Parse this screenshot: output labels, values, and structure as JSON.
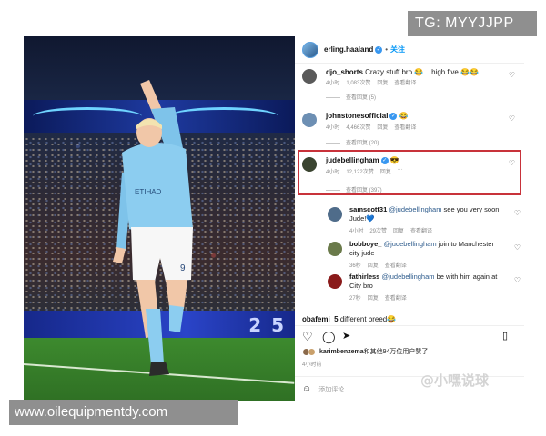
{
  "watermarks": {
    "tg": "TG: MYYJJPP",
    "site": "www.oilequipmentdy.com",
    "corner": "@小嘿说球"
  },
  "photo": {
    "jersey_text": "ETIHAD",
    "shorts_number": "9",
    "board_text": "2 5"
  },
  "post": {
    "username": "erling.haaland",
    "dot": "•",
    "follow_label": "关注"
  },
  "comments": [
    {
      "user": "djo_shorts",
      "text": "Crazy stuff bro 😂 .. high five 😂😂",
      "time": "4小时",
      "likes": "1,083次赞",
      "reply": "回复",
      "translate": "查看翻译",
      "replies": "查看回复 (5)"
    },
    {
      "user": "johnstonesofficial",
      "text": "😂",
      "time": "4小时",
      "likes": "4,466次赞",
      "reply": "回复",
      "translate": "查看翻译",
      "replies": "查看回复 (20)"
    },
    {
      "user": "judebellingham",
      "text": "😎",
      "time": "4小时",
      "likes": "12,122次赞",
      "reply": "回复",
      "more": "···",
      "replies": "查看回复 (397)"
    }
  ],
  "subreplies": [
    {
      "user": "samscott31",
      "mention": "@judebellingham",
      "text": " see you very soon Jude!💙",
      "time": "4小时",
      "likes": "29次赞",
      "reply": "回复",
      "translate": "查看翻译"
    },
    {
      "user": "bobboye_",
      "mention": "@judebellingham",
      "text": " join to Manchester city jude",
      "time": "36秒",
      "likes": "回复",
      "reply": "",
      "translate": "查看翻译"
    },
    {
      "user": "fathirless",
      "mention": "@judebellingham",
      "text": " be with him again at City bro",
      "time": "27秒",
      "likes": "回复",
      "reply": "",
      "translate": "查看翻译"
    }
  ],
  "partial_comment": {
    "user": "obafemi_5",
    "text": "different breed😂"
  },
  "likes_line": {
    "user": "karimbenzema",
    "text": "和其他94万位用户赞了"
  },
  "post_time": "4小时前",
  "add_comment": {
    "emoji": "☺",
    "placeholder": "添加评论..."
  },
  "icons": {
    "heart": "heart-icon",
    "comment": "comment-icon",
    "share": "share-icon",
    "save": "bookmark-icon"
  }
}
